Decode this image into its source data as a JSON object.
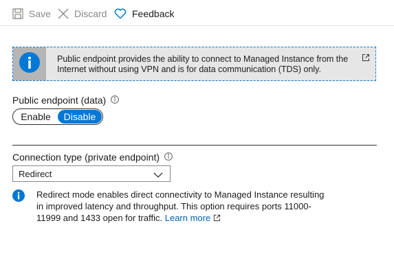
{
  "toolbar": {
    "save_label": "Save",
    "discard_label": "Discard",
    "feedback_label": "Feedback"
  },
  "banner": {
    "text": "Public endpoint provides the ability to connect to Managed Instance from the Internet without using VPN and is for data communication (TDS) only.",
    "icon": "info-icon",
    "action_icon": "external-link-icon"
  },
  "public_endpoint": {
    "label": "Public endpoint (data)",
    "options": [
      "Enable",
      "Disable"
    ],
    "selected": "Disable"
  },
  "connection_type": {
    "label": "Connection type (private endpoint)",
    "value": "Redirect"
  },
  "note": {
    "text": "Redirect mode enables direct connectivity to Managed Instance resulting in improved latency and throughput. This option requires ports 11000-11999 and 1433 open for traffic.",
    "link_label": "Learn more"
  },
  "colors": {
    "accent": "#0078d4",
    "banner_bg": "#e6e6e6",
    "banner_icon_bg": "#b5b5b5",
    "disabled_text": "#8a8886"
  }
}
